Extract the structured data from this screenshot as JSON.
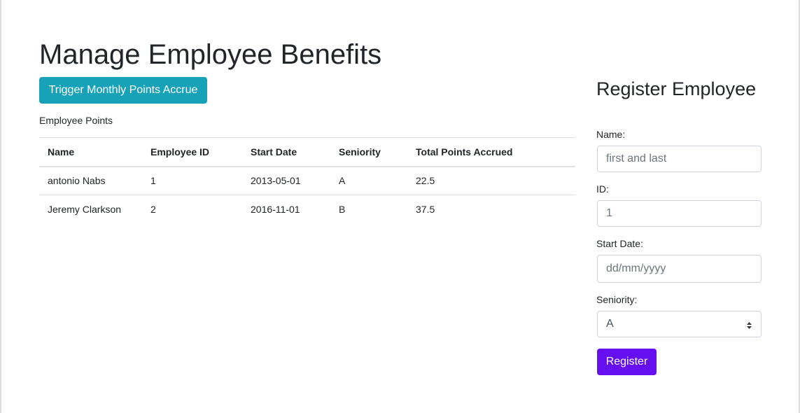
{
  "page": {
    "title": "Manage Employee Benefits"
  },
  "actions": {
    "accrue_label": "Trigger Monthly Points Accrue"
  },
  "points_table": {
    "caption": "Employee Points",
    "columns": [
      "Name",
      "Employee ID",
      "Start Date",
      "Seniority",
      "Total Points Accrued"
    ],
    "rows": [
      [
        "antonio Nabs",
        "1",
        "2013-05-01",
        "A",
        "22.5"
      ],
      [
        "Jeremy Clarkson",
        "2",
        "2016-11-01",
        "B",
        "37.5"
      ]
    ]
  },
  "register": {
    "title": "Register Employee",
    "name_label": "Name:",
    "name_placeholder": "first and last",
    "id_label": "ID:",
    "id_placeholder": "1",
    "start_date_label": "Start Date:",
    "start_date_placeholder": "dd/mm/yyyy",
    "seniority_label": "Seniority:",
    "seniority_value": "A",
    "submit_label": "Register"
  },
  "colors": {
    "accrue_button": "#17a2b8",
    "register_button": "#6610f2"
  },
  "icons": {
    "select_caret": "select-caret-icon"
  }
}
